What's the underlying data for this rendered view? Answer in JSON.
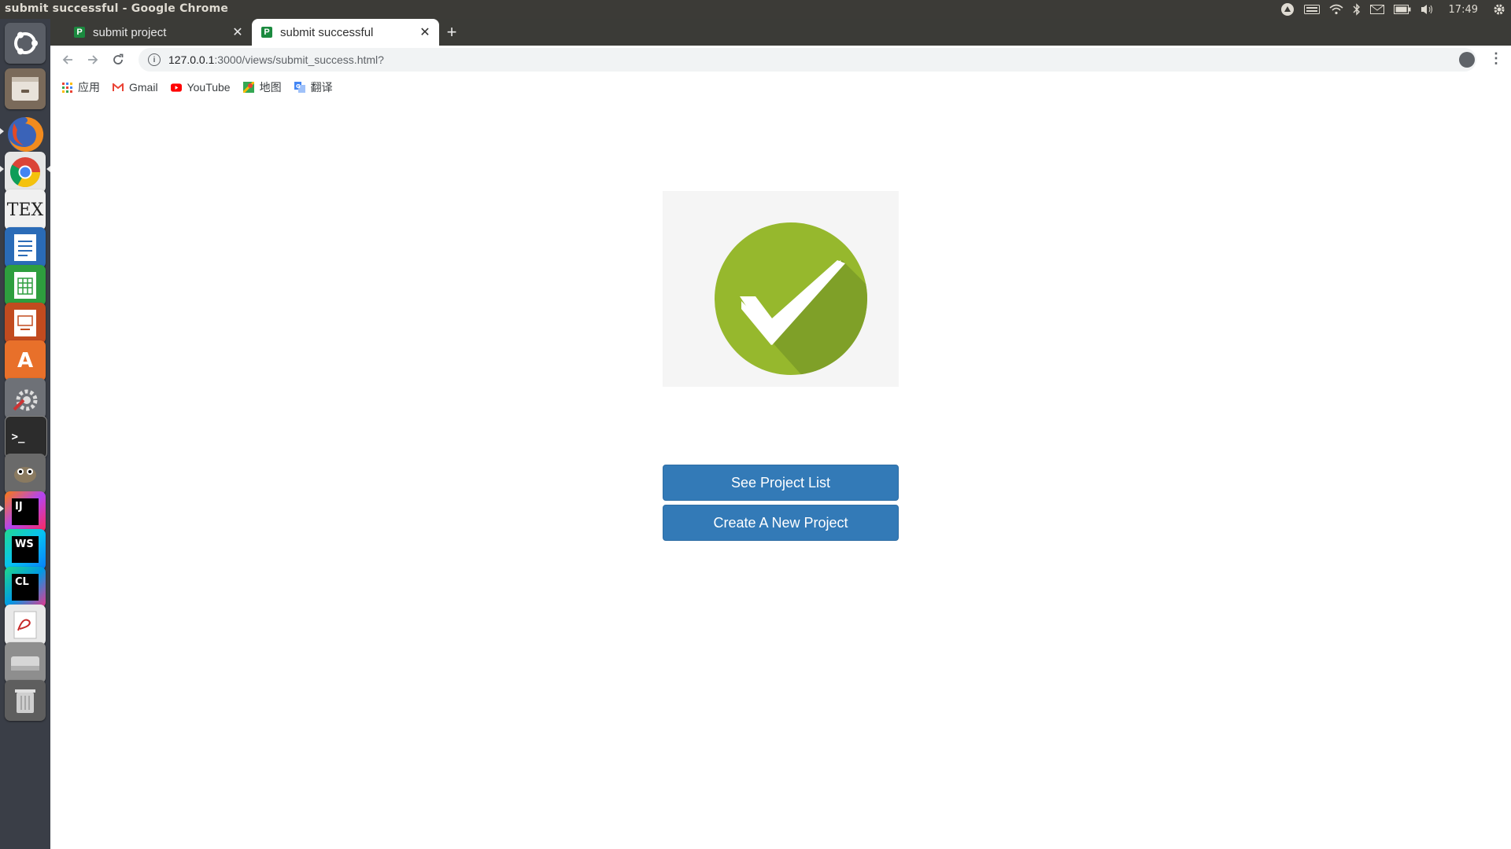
{
  "os": {
    "window_title": "submit successful - Google Chrome",
    "clock": "17:49",
    "tray_icons": [
      "ubuntu-one-icon",
      "keyboard-icon",
      "wifi-icon",
      "bluetooth-icon",
      "mail-icon",
      "battery-icon",
      "volume-icon",
      "settings-gear-icon"
    ],
    "launcher": [
      {
        "name": "ubuntu-dash",
        "color": "#5a5e66"
      },
      {
        "name": "files",
        "color": "#7a6a5a"
      },
      {
        "name": "firefox",
        "color": "#e8642c"
      },
      {
        "name": "chrome",
        "color": "#e9e9e9"
      },
      {
        "name": "texworks",
        "label": "TEX",
        "color": "#f0f0f0"
      },
      {
        "name": "libreoffice-writer",
        "color": "#2a6bb7"
      },
      {
        "name": "libreoffice-calc",
        "color": "#2e9e3e"
      },
      {
        "name": "libreoffice-impress",
        "color": "#c24b1f"
      },
      {
        "name": "software-center",
        "color": "#e8702a"
      },
      {
        "name": "system-settings",
        "color": "#7a7d82"
      },
      {
        "name": "terminal",
        "color": "#2c2c2c"
      },
      {
        "name": "gimp",
        "color": "#6a6a6a"
      },
      {
        "name": "intellij",
        "label": "IJ",
        "color": "#c62e8e"
      },
      {
        "name": "webstorm",
        "label": "WS",
        "color": "#1f9fd8"
      },
      {
        "name": "clion",
        "label": "CL",
        "color": "#21c29a"
      },
      {
        "name": "pdf-viewer",
        "color": "#e8e8e8"
      },
      {
        "name": "disk",
        "color": "#bfbfbf"
      },
      {
        "name": "trash",
        "color": "#9a9a9a"
      }
    ]
  },
  "browser": {
    "tabs": [
      {
        "label": "submit project",
        "favicon": "P",
        "active": false
      },
      {
        "label": "submit successful",
        "favicon": "P",
        "active": true
      }
    ],
    "new_tab_label": "+",
    "url_host": "127.0.0.1",
    "url_rest": ":3000/views/submit_success.html?",
    "bookmarks": [
      {
        "label": "应用",
        "icon": "apps-grid-icon"
      },
      {
        "label": "Gmail",
        "icon": "gmail-icon"
      },
      {
        "label": "YouTube",
        "icon": "youtube-icon"
      },
      {
        "label": "地图",
        "icon": "maps-icon"
      },
      {
        "label": "翻译",
        "icon": "translate-icon"
      }
    ]
  },
  "page": {
    "success_icon": "checkmark-circle-icon",
    "accent": "#96b82d",
    "button_color": "#337ab7",
    "see_list_label": "See Project List",
    "create_new_label": "Create A New Project"
  }
}
